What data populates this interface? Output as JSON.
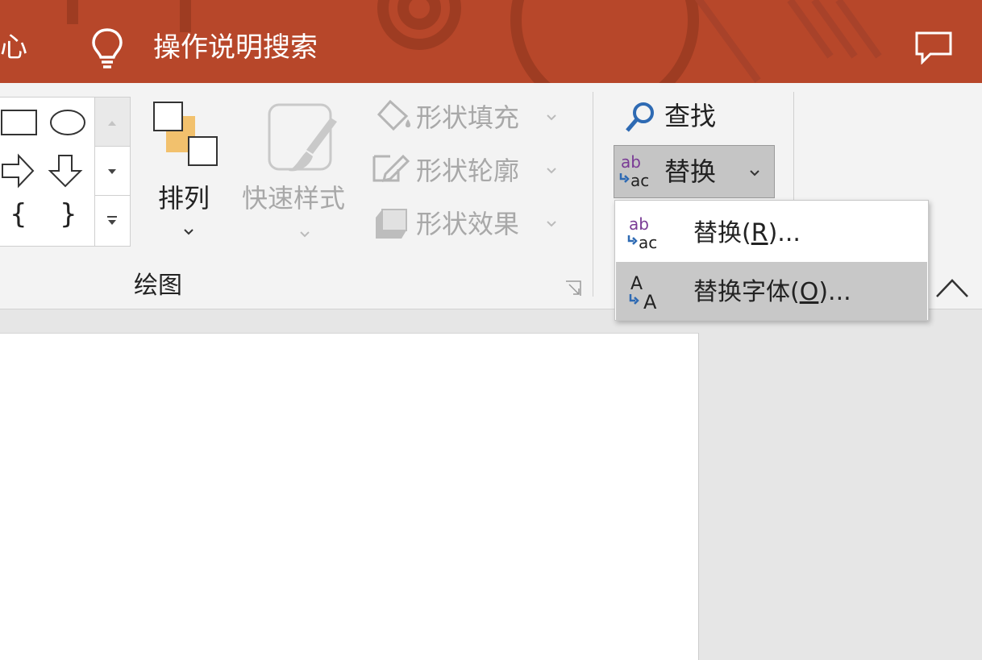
{
  "titlebar": {
    "partial_left_text": "心",
    "search_label": "操作说明搜索"
  },
  "ribbon": {
    "drawing_group": {
      "arrange_label": "排列",
      "quick_styles_label": "快速样式",
      "shape_fill_label": "形状填充",
      "shape_outline_label": "形状轮廓",
      "shape_effects_label": "形状效果",
      "group_label": "绘图",
      "shapes": [
        "rectangle",
        "oval",
        "right-arrow",
        "down-arrow",
        "left-brace",
        "right-brace"
      ],
      "brace_left": "{",
      "brace_right": "}"
    },
    "editing_group": {
      "find_label": "查找",
      "replace_label": "替换"
    }
  },
  "replace_menu": {
    "items": [
      {
        "pre": "替换(",
        "key": "R",
        "post": ")...",
        "selected": false
      },
      {
        "pre": "替换字体(",
        "key": "O",
        "post": ")...",
        "selected": true
      }
    ]
  },
  "colors": {
    "title_bar": "#b7472a",
    "ribbon_bg": "#f3f3f3",
    "menu_selected": "#c8c8c8",
    "icon_purple": "#7a3b95",
    "icon_blue": "#2e6ab3"
  }
}
